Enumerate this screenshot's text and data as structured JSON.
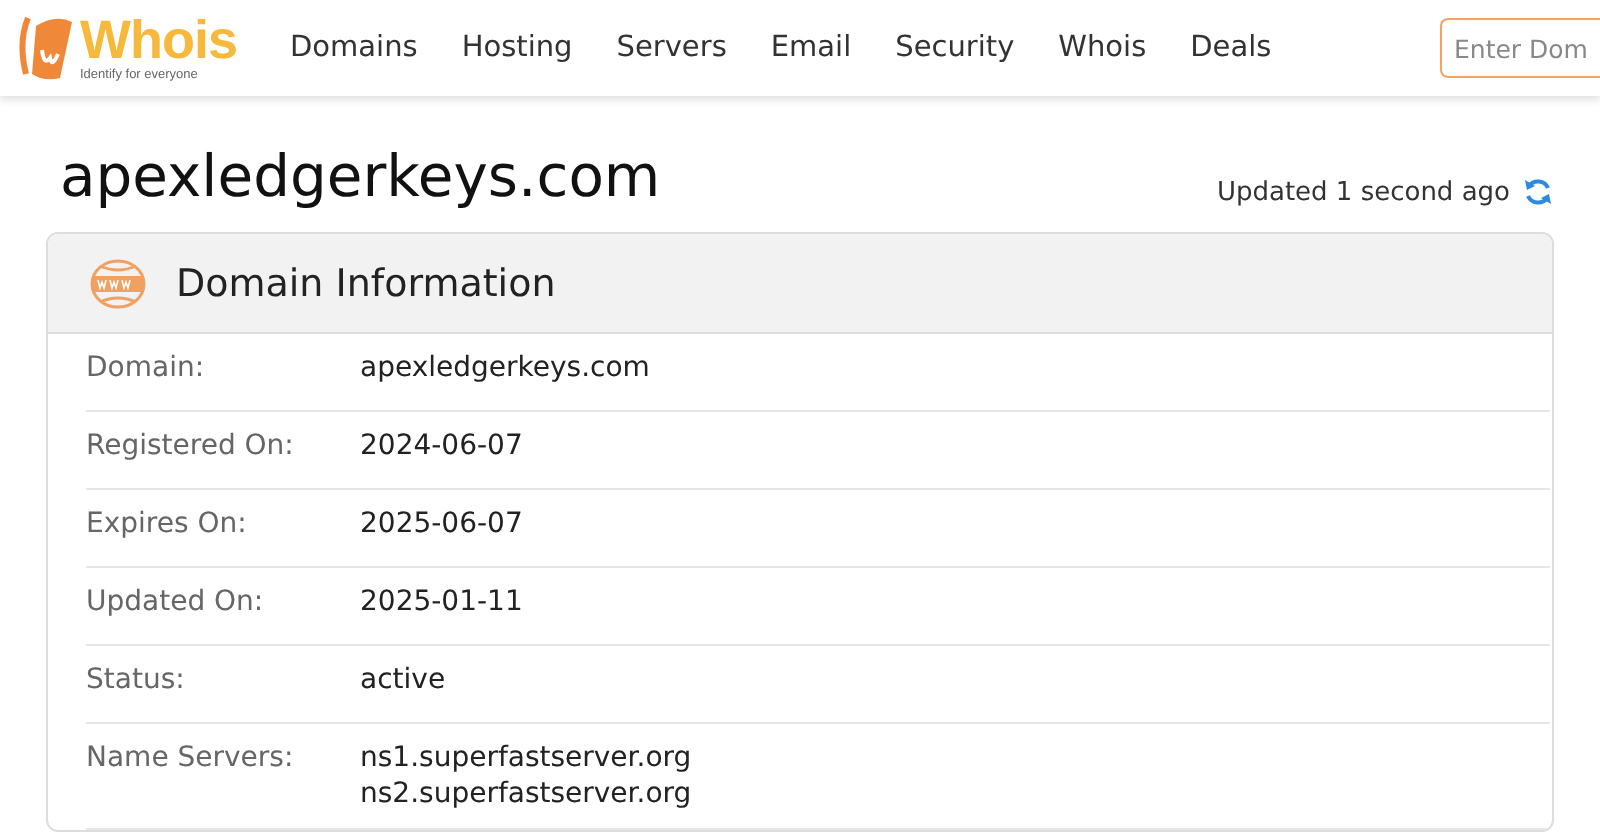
{
  "header": {
    "logo": {
      "name": "Whois",
      "tagline": "Identify for everyone"
    },
    "nav": [
      {
        "label": "Domains"
      },
      {
        "label": "Hosting"
      },
      {
        "label": "Servers"
      },
      {
        "label": "Email"
      },
      {
        "label": "Security"
      },
      {
        "label": "Whois"
      },
      {
        "label": "Deals"
      }
    ],
    "search": {
      "placeholder": "Enter Dom"
    }
  },
  "page_title": "apexledgerkeys.com",
  "updated": "Updated 1 second ago",
  "card": {
    "title": "Domain Information",
    "rows": [
      {
        "label": "Domain:",
        "values": [
          "apexledgerkeys.com"
        ]
      },
      {
        "label": "Registered On:",
        "values": [
          "2024-06-07"
        ]
      },
      {
        "label": "Expires On:",
        "values": [
          "2025-06-07"
        ]
      },
      {
        "label": "Updated On:",
        "values": [
          "2025-01-11"
        ]
      },
      {
        "label": "Status:",
        "values": [
          "active"
        ]
      },
      {
        "label": "Name Servers:",
        "values": [
          "ns1.superfastserver.org",
          "ns2.superfastserver.org"
        ]
      }
    ]
  }
}
